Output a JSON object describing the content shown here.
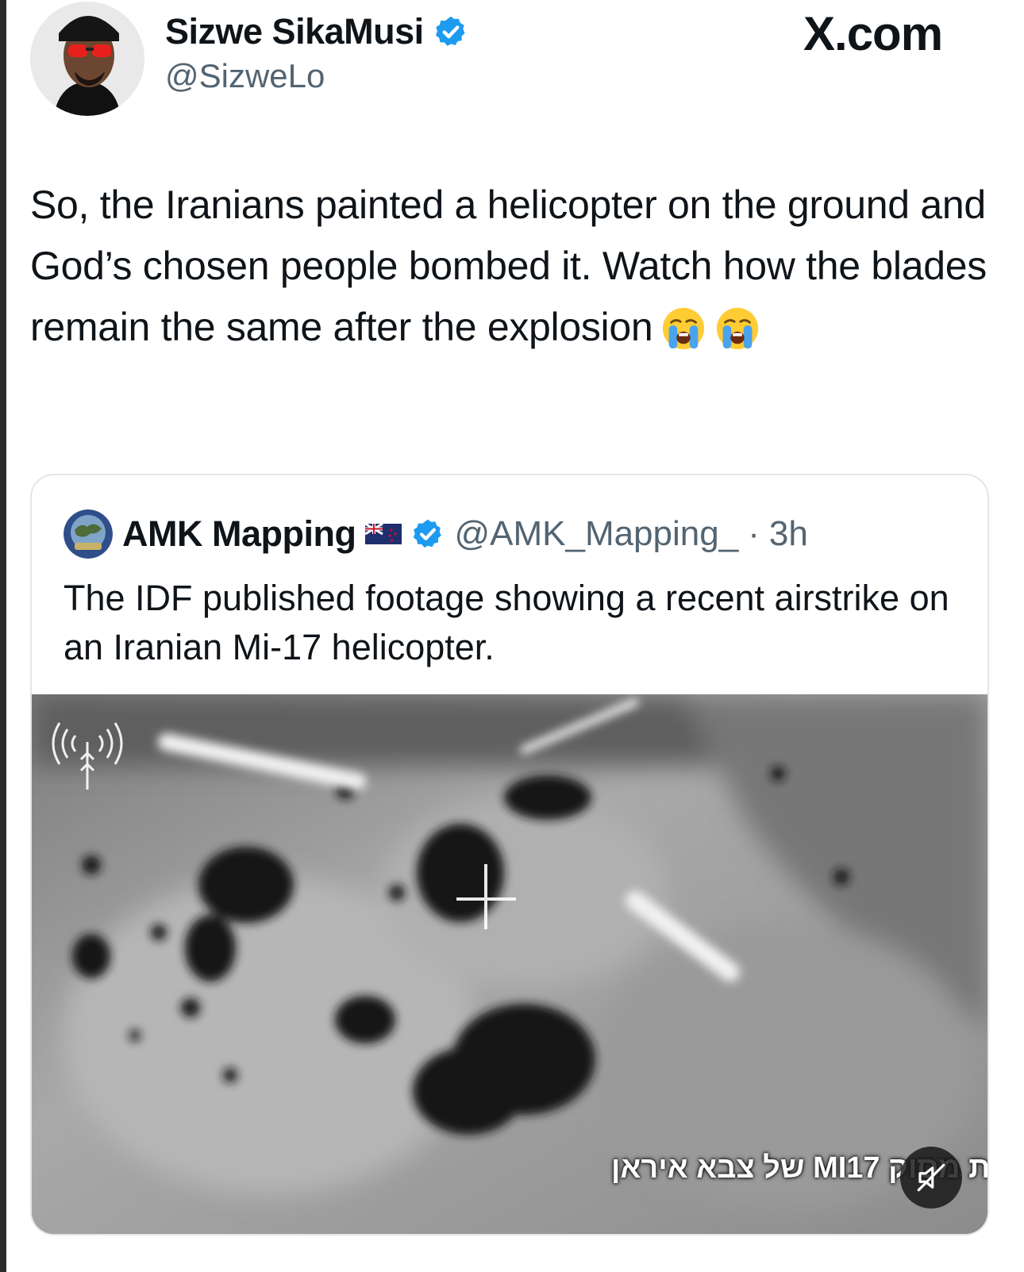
{
  "author": {
    "display_name": "Sizwe SikaMusi",
    "handle": "@SizweLo",
    "verified_icon": "verified-badge-icon",
    "avatar_icon": "profile-photo-avatar"
  },
  "site": {
    "label": "X.com"
  },
  "tweet": {
    "text": "So, the Iranians painted a helicopter on the ground and God’s chosen people bombed it. Watch how the blades remain the same after the explosion",
    "emojis": [
      "loudly-crying-face-icon",
      "loudly-crying-face-icon"
    ]
  },
  "quoted_tweet": {
    "display_name": "AMK Mapping",
    "handle": "@AMK_Mapping_",
    "separator": "·",
    "time": "3h",
    "text": "The IDF published footage showing a recent airstrike on an Iranian Mi-17 helicopter.",
    "flag_icon": "new-zealand-flag-icon",
    "verified_icon": "verified-badge-icon",
    "video": {
      "caption": "תקיפת מסוק MI17 של צבא איראן",
      "mute_icon": "muted-speaker-icon",
      "watermark_icon": "idf-signal-logo-icon"
    }
  },
  "colors": {
    "verified_blue": "#1d9bf0",
    "secondary_text": "#536471",
    "card_border": "#e1e6ea"
  }
}
